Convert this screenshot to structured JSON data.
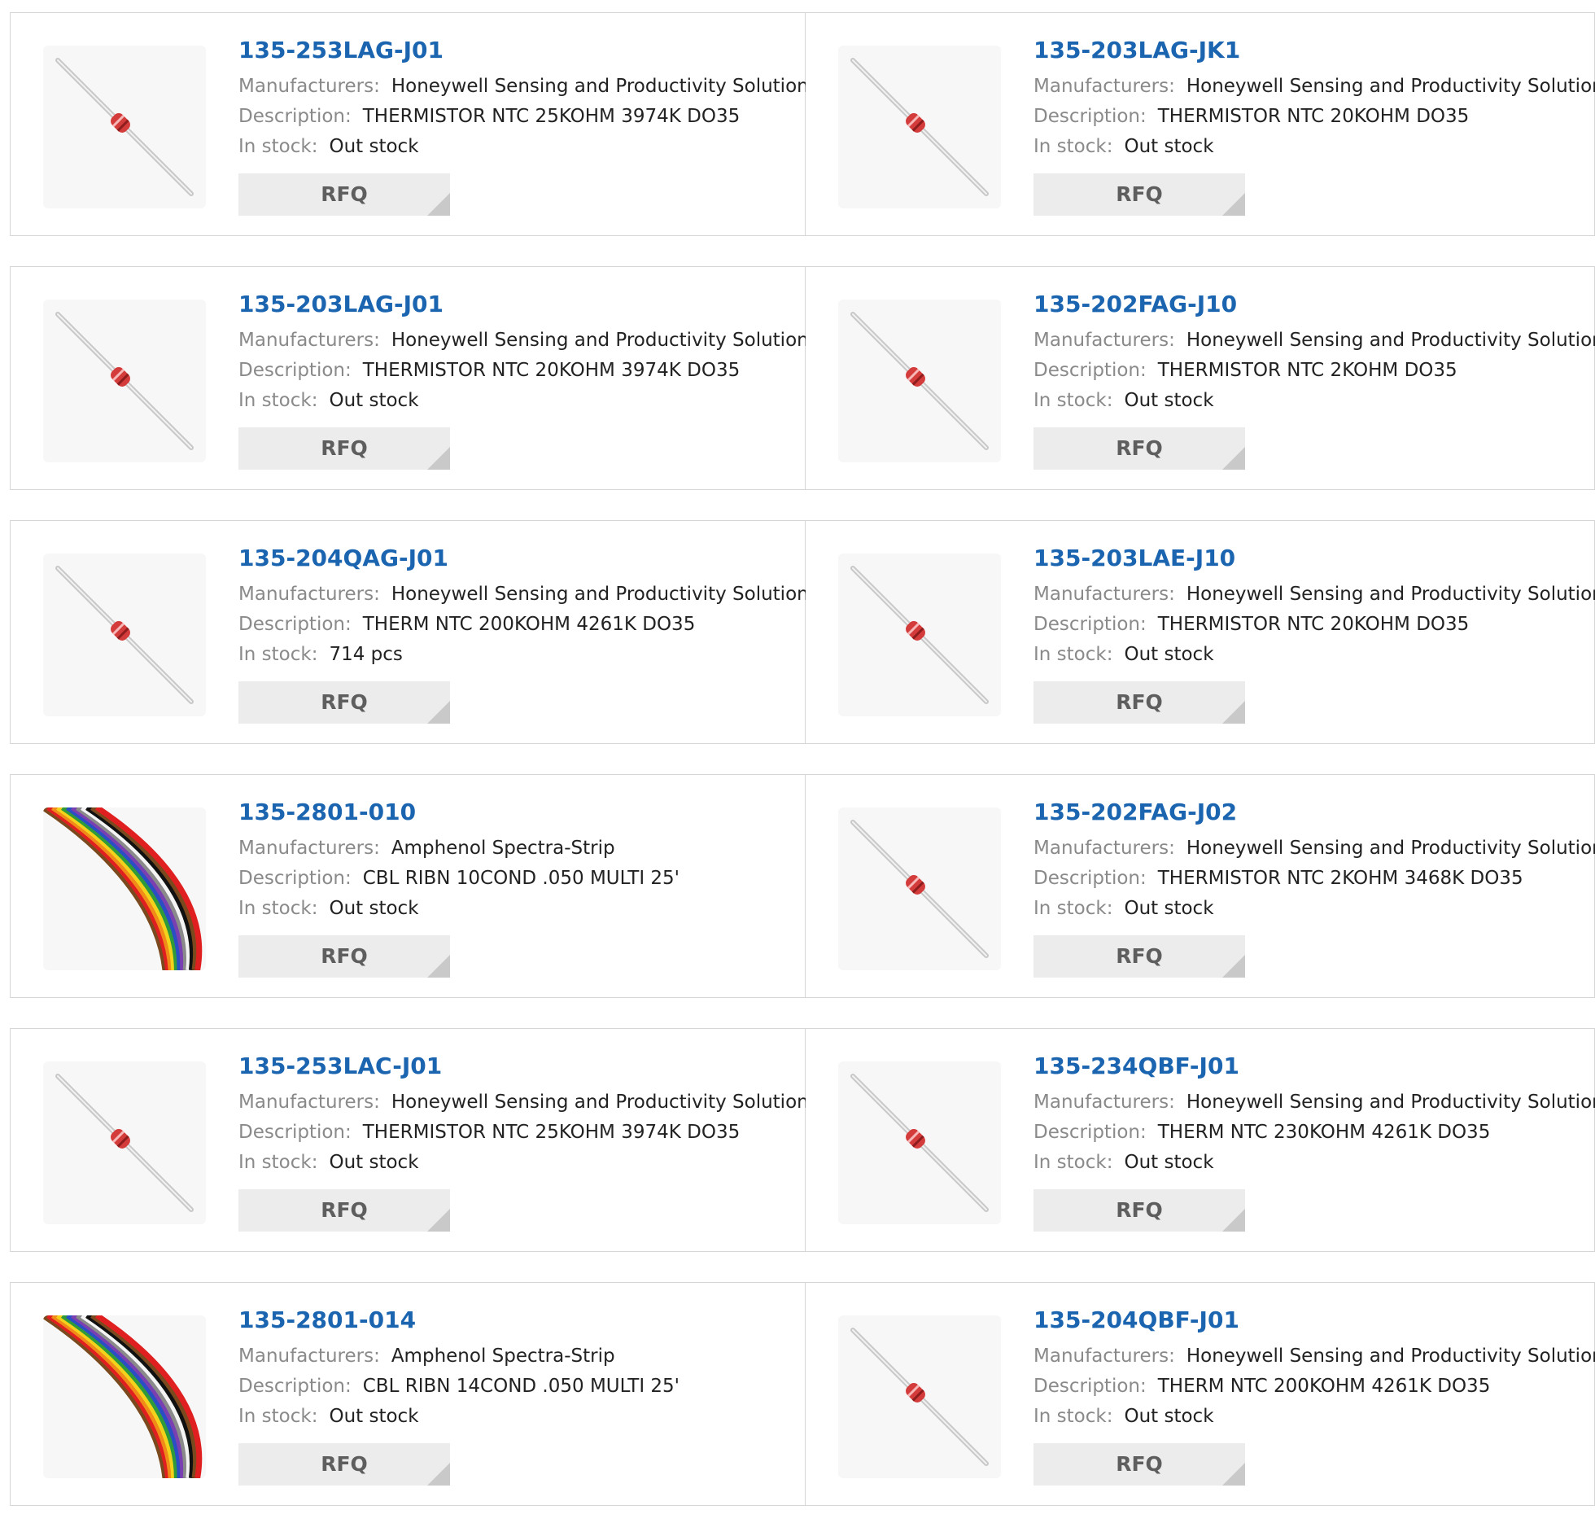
{
  "labels": {
    "manufacturer": "Manufacturers:",
    "description": "Description:",
    "stock": "In stock:",
    "rfq": "RFQ"
  },
  "colors": {
    "part_link": "#1a64b0",
    "label": "#8a8a8a",
    "button_bg": "#ececec"
  },
  "products": [
    {
      "part": "135-253LAG-J01",
      "manufacturer": "Honeywell Sensing and Productivity Solutions",
      "description": "THERMISTOR NTC 25KOHM 3974K DO35",
      "stock": "Out stock",
      "image": "thermistor-image"
    },
    {
      "part": "135-203LAG-JK1",
      "manufacturer": "Honeywell Sensing and Productivity Solutions",
      "description": "THERMISTOR NTC 20KOHM DO35",
      "stock": "Out stock",
      "image": "thermistor-image"
    },
    {
      "part": "135-203LAG-J01",
      "manufacturer": "Honeywell Sensing and Productivity Solutions",
      "description": "THERMISTOR NTC 20KOHM 3974K DO35",
      "stock": "Out stock",
      "image": "thermistor-image"
    },
    {
      "part": "135-202FAG-J10",
      "manufacturer": "Honeywell Sensing and Productivity Solutions",
      "description": "THERMISTOR NTC 2KOHM DO35",
      "stock": "Out stock",
      "image": "thermistor-image"
    },
    {
      "part": "135-204QAG-J01",
      "manufacturer": "Honeywell Sensing and Productivity Solutions",
      "description": "THERM NTC 200KOHM 4261K DO35",
      "stock": "714 pcs",
      "image": "thermistor-image"
    },
    {
      "part": "135-203LAE-J10",
      "manufacturer": "Honeywell Sensing and Productivity Solutions",
      "description": "THERMISTOR NTC 20KOHM DO35",
      "stock": "Out stock",
      "image": "thermistor-image"
    },
    {
      "part": "135-2801-010",
      "manufacturer": "Amphenol Spectra-Strip",
      "description": "CBL RIBN 10COND .050 MULTI 25'",
      "stock": "Out stock",
      "image": "ribbon-cable-image"
    },
    {
      "part": "135-202FAG-J02",
      "manufacturer": "Honeywell Sensing and Productivity Solutions",
      "description": "THERMISTOR NTC 2KOHM 3468K DO35",
      "stock": "Out stock",
      "image": "thermistor-image"
    },
    {
      "part": "135-253LAC-J01",
      "manufacturer": "Honeywell Sensing and Productivity Solutions",
      "description": "THERMISTOR NTC 25KOHM 3974K DO35",
      "stock": "Out stock",
      "image": "thermistor-image"
    },
    {
      "part": "135-234QBF-J01",
      "manufacturer": "Honeywell Sensing and Productivity Solutions",
      "description": "THERM NTC 230KOHM 4261K DO35",
      "stock": "Out stock",
      "image": "thermistor-image"
    },
    {
      "part": "135-2801-014",
      "manufacturer": "Amphenol Spectra-Strip",
      "description": "CBL RIBN 14COND .050 MULTI 25'",
      "stock": "Out stock",
      "image": "ribbon-cable-image"
    },
    {
      "part": "135-204QBF-J01",
      "manufacturer": "Honeywell Sensing and Productivity Solutions",
      "description": "THERM NTC 200KOHM 4261K DO35",
      "stock": "Out stock",
      "image": "thermistor-image"
    }
  ]
}
